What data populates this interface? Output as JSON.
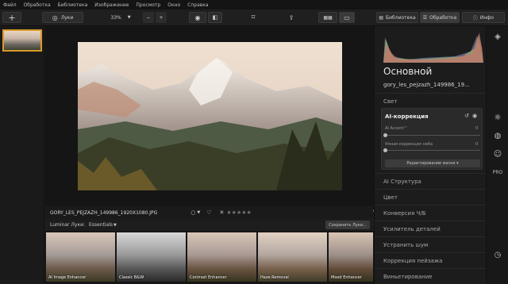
{
  "menu": [
    "Файл",
    "Обработка",
    "Библиотека",
    "Изображение",
    "Просмотр",
    "Окно",
    "Справка"
  ],
  "toolbar": {
    "add_icon": "plus-icon",
    "looks_label": "Луки",
    "zoom_value": "33%",
    "zoom_minus": "−",
    "zoom_plus": "+",
    "library_label": "Библиотека",
    "edit_label": "Обработка",
    "info_label": "Инфо"
  },
  "panel": {
    "title": "Основной",
    "filename": "gory_les_pejzazh_149986_19...",
    "light_section": "Свет",
    "ai": {
      "title": "AI-коррекция",
      "accent_label": "AI Accent™",
      "accent_value": "0",
      "sky_label": "Умная коррекция неба",
      "sky_value": "0",
      "mask_button": "Редактирование маски ▾"
    },
    "sections": [
      "AI Структура",
      "Цвет",
      "Конверсия Ч/Б",
      "Усилитель деталей",
      "Устранить шум",
      "Коррекция пейзажа",
      "Виньетирование"
    ]
  },
  "infobar": {
    "filename": "GORY_LES_PEJZAZH_149986_1920X1080.JPG",
    "rating_stars": "★★★★★",
    "flag_icon": "circle-icon",
    "heart_icon": "heart-icon",
    "reject_icon": "x-icon"
  },
  "presets": {
    "label": "Luminar Луки:",
    "category": "Essentials",
    "save_label": "Сохранить Луки...",
    "items": [
      "AI Image Enhancer",
      "Classic B&W",
      "Contrast Enhancer",
      "Haze Removal",
      "Mood Enhancer"
    ]
  },
  "colors": {
    "accent": "#d89a2a",
    "background": "#1c1c1c"
  }
}
